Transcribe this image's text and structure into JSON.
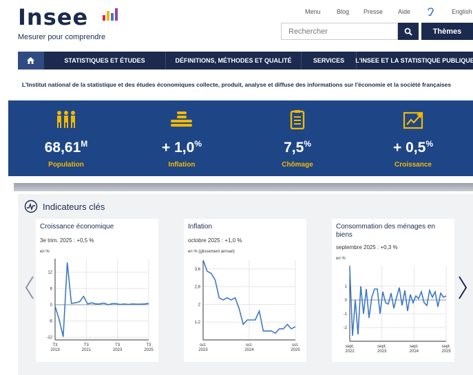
{
  "header": {
    "logo_word": "Insee",
    "logo_tagline": "Mesurer pour comprendre",
    "top_links": [
      "Menu",
      "Blog",
      "Presse",
      "Aide",
      "English"
    ],
    "search_placeholder": "Rechercher",
    "themes_label": "Thèmes",
    "search_button_icon": "search-icon"
  },
  "nav": {
    "home_icon": "home-icon",
    "items": [
      "STATISTIQUES ET ÉTUDES",
      "DÉFINITIONS, MÉTHODES ET QUALITÉ",
      "SERVICES",
      "L'INSEE ET LA STATISTIQUE PUBLIQUE"
    ]
  },
  "intro": "L'Institut national de la statistique et des études économiques collecte, produit, analyse et diffuse des informations sur l'économie et la société françaises",
  "stats": [
    {
      "value": "68,61",
      "suffix": "M",
      "label": "Population",
      "icon": "people-icon"
    },
    {
      "value": "+ 1,0",
      "suffix": "%",
      "label": "Inflation",
      "icon": "coins-icon"
    },
    {
      "value": "7,5",
      "suffix": "%",
      "label": "Chômage",
      "icon": "clipboard-icon"
    },
    {
      "value": "+ 0,5",
      "suffix": "%",
      "label": "Croissance",
      "icon": "trend-up-icon"
    }
  ],
  "indicators": {
    "title": "Indicateurs clés",
    "icon": "pulse-icon"
  },
  "colors": {
    "navy": "#1b2a4e",
    "band": "#1e4686",
    "accent": "#f2b705",
    "line": "#3d78c4"
  },
  "chart_data": [
    {
      "type": "line",
      "title": "Croissance économique",
      "subtitle": "3e trim. 2025 : +0,5 %",
      "ylabel": "en %",
      "ylim": [
        -13,
        17
      ],
      "yticks": [
        "12",
        "6",
        "0",
        "-6",
        "-12"
      ],
      "xticks": [
        "T3\n2019",
        "T3\n2021",
        "T3\n2023",
        "T3\n2025"
      ],
      "values": [
        -0.5,
        -5.5,
        -11.8,
        15.6,
        0.5,
        0.7,
        1.1,
        3.1,
        0.3,
        0.7,
        0.3,
        0.3,
        0.6,
        0.0,
        0.4,
        0.4,
        0.1,
        0.3,
        0.1,
        0.3,
        0.2,
        0.2,
        0.3,
        0.5
      ]
    },
    {
      "type": "line",
      "title": "Inflation",
      "subtitle": "octobre 2025 : +1,0 %",
      "ylabel": "en % (glissement annuel)",
      "ylim": [
        0.4,
        4.0
      ],
      "yticks": [
        "3,6",
        "2,8",
        "2",
        "1,2"
      ],
      "xticks": [
        "oct.\n2023",
        "oct.\n2024",
        "oct.\n2025"
      ],
      "values": [
        4.0,
        3.5,
        3.4,
        3.1,
        2.3,
        2.2,
        2.3,
        2.2,
        2.3,
        1.8,
        1.1,
        1.3,
        1.3,
        1.3,
        1.7,
        0.8,
        0.8,
        0.8,
        0.7,
        0.9,
        0.9,
        1.1,
        0.9,
        1.0
      ]
    },
    {
      "type": "line",
      "title": "Consommation des ménages en biens",
      "subtitle": "septembre 2025 : +0,3 %",
      "ylabel": "en %",
      "ylim": [
        -3,
        2.5
      ],
      "yticks": [
        "1",
        "0",
        "-1",
        "-2"
      ],
      "xticks": [
        "sept.\n2022",
        "sept.\n2023",
        "sept.\n2024",
        "sept.\n2025"
      ],
      "values": [
        2.3,
        -2.6,
        0.0,
        -2.5,
        1.0,
        -1.0,
        0.8,
        -1.3,
        0.2,
        0.8,
        0.8,
        -1.0,
        0.6,
        -0.2,
        -0.3,
        0.5,
        -0.6,
        0.2,
        0.9,
        -0.4,
        0.7,
        -0.8,
        0.4,
        -0.2,
        0.3,
        0.1,
        0.6,
        -0.2,
        -0.4,
        0.7,
        0.2,
        0.6,
        -0.5,
        0.5,
        0.2,
        0.3
      ]
    }
  ]
}
